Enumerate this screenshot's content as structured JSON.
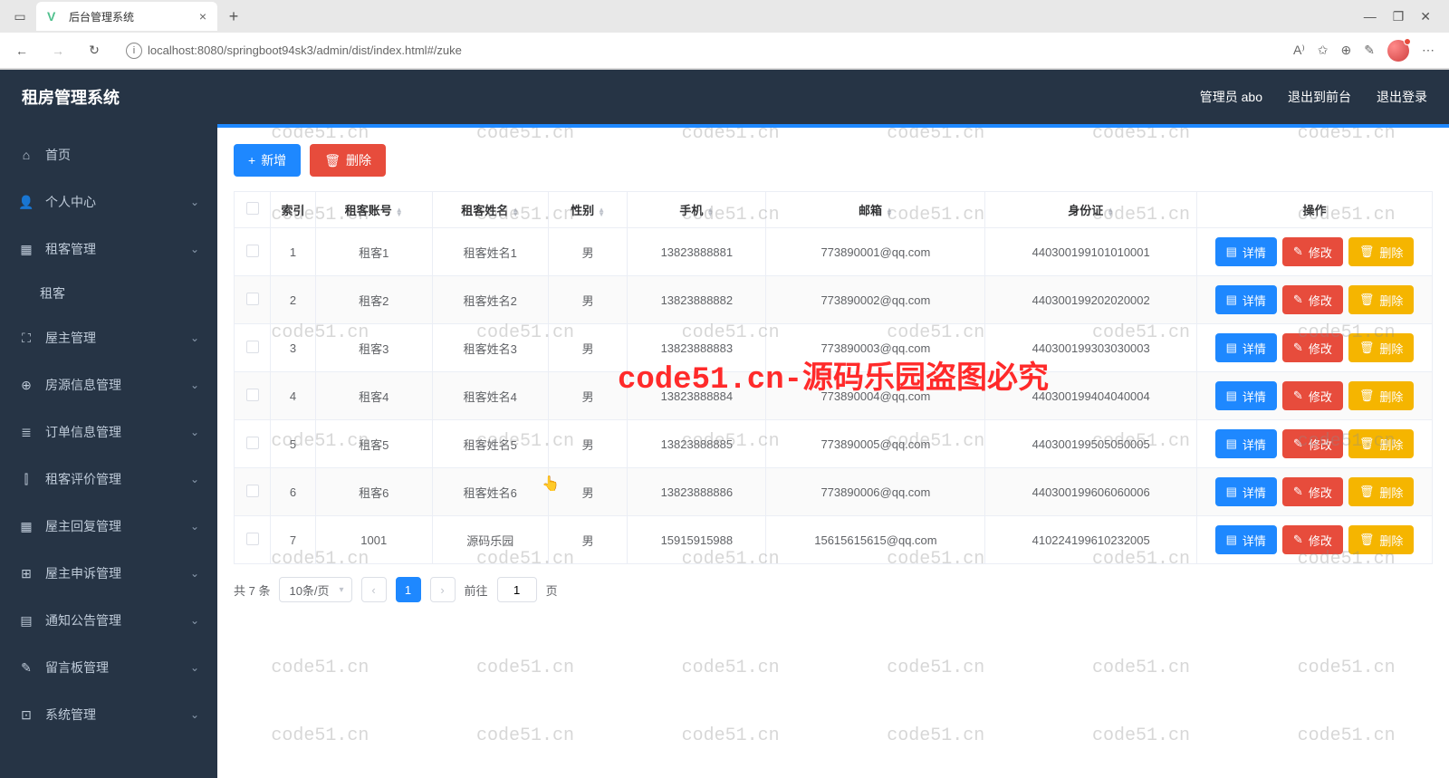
{
  "browser": {
    "tab_title": "后台管理系统",
    "url": "localhost:8080/springboot94sk3/admin/dist/index.html#/zuke"
  },
  "header": {
    "app_title": "租房管理系统",
    "admin_label": "管理员 abo",
    "exit_front": "退出到前台",
    "logout": "退出登录"
  },
  "sidebar": {
    "items": [
      {
        "label": "首页",
        "icon": "⌂"
      },
      {
        "label": "个人中心",
        "icon": "👤"
      },
      {
        "label": "租客管理",
        "icon": "▦",
        "expanded": true,
        "children": [
          {
            "label": "租客"
          }
        ]
      },
      {
        "label": "屋主管理",
        "icon": "⛶"
      },
      {
        "label": "房源信息管理",
        "icon": "⊕"
      },
      {
        "label": "订单信息管理",
        "icon": "≣"
      },
      {
        "label": "租客评价管理",
        "icon": "⫿"
      },
      {
        "label": "屋主回复管理",
        "icon": "▦"
      },
      {
        "label": "屋主申诉管理",
        "icon": "⊞"
      },
      {
        "label": "通知公告管理",
        "icon": "▤"
      },
      {
        "label": "留言板管理",
        "icon": "✎"
      },
      {
        "label": "系统管理",
        "icon": "⊡"
      }
    ]
  },
  "toolbar": {
    "add_label": "新增",
    "delete_label": "删除"
  },
  "table": {
    "headers": {
      "index": "索引",
      "account": "租客账号",
      "name": "租客姓名",
      "gender": "性别",
      "phone": "手机",
      "email": "邮箱",
      "idcard": "身份证",
      "ops": "操作"
    },
    "op_labels": {
      "detail": "详情",
      "edit": "修改",
      "delete": "删除"
    },
    "rows": [
      {
        "idx": "1",
        "account": "租客1",
        "name": "租客姓名1",
        "gender": "男",
        "phone": "13823888881",
        "email": "773890001@qq.com",
        "idcard": "440300199101010001"
      },
      {
        "idx": "2",
        "account": "租客2",
        "name": "租客姓名2",
        "gender": "男",
        "phone": "13823888882",
        "email": "773890002@qq.com",
        "idcard": "440300199202020002"
      },
      {
        "idx": "3",
        "account": "租客3",
        "name": "租客姓名3",
        "gender": "男",
        "phone": "13823888883",
        "email": "773890003@qq.com",
        "idcard": "440300199303030003"
      },
      {
        "idx": "4",
        "account": "租客4",
        "name": "租客姓名4",
        "gender": "男",
        "phone": "13823888884",
        "email": "773890004@qq.com",
        "idcard": "440300199404040004"
      },
      {
        "idx": "5",
        "account": "租客5",
        "name": "租客姓名5",
        "gender": "男",
        "phone": "13823888885",
        "email": "773890005@qq.com",
        "idcard": "440300199505050005"
      },
      {
        "idx": "6",
        "account": "租客6",
        "name": "租客姓名6",
        "gender": "男",
        "phone": "13823888886",
        "email": "773890006@qq.com",
        "idcard": "440300199606060006"
      },
      {
        "idx": "7",
        "account": "1001",
        "name": "源码乐园",
        "gender": "男",
        "phone": "15915915988",
        "email": "15615615615@qq.com",
        "idcard": "410224199610232005"
      }
    ]
  },
  "pagination": {
    "total": "共 7 条",
    "page_size": "10条/页",
    "current": "1",
    "goto_prefix": "前往",
    "goto_value": "1",
    "goto_suffix": "页"
  },
  "watermark": {
    "small": "code51.cn",
    "big": "code51.cn-源码乐园盗图必究"
  }
}
